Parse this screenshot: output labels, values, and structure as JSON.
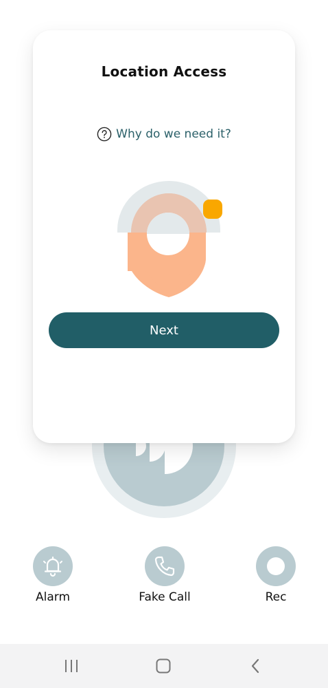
{
  "card": {
    "title": "Location Access",
    "help_link": "Why do we need it?",
    "next_label": "Next"
  },
  "actions": [
    {
      "label": "Alarm",
      "icon": "bell-icon"
    },
    {
      "label": "Fake Call",
      "icon": "phone-icon"
    },
    {
      "label": "Rec",
      "icon": "record-icon"
    }
  ],
  "icons": {
    "panic": "sound-wave-icon",
    "help": "question-circle-icon",
    "illustration": "location-pin-icon"
  },
  "colors": {
    "primary": "#215e67",
    "pin": "#fbb58b",
    "accent_dot": "#f9a700",
    "muted_circle": "#b9cbd0",
    "navbar": "#f3f3f4"
  }
}
